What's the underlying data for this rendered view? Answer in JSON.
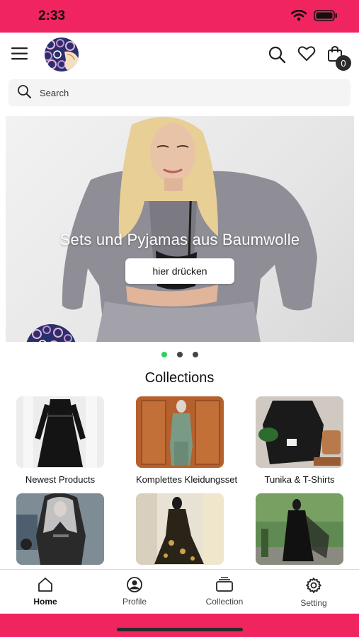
{
  "status_bar": {
    "time": "2:33"
  },
  "header": {
    "cart_count": "0"
  },
  "search": {
    "placeholder": "Search"
  },
  "hero": {
    "title": "Sets und Pyjamas aus Baumwolle",
    "button_label": "hier drücken",
    "slide_count": 3,
    "active_slide": 1
  },
  "collections": {
    "title": "Collections",
    "items": [
      {
        "label": "Newest Products"
      },
      {
        "label": "Komplettes Kleidungsset"
      },
      {
        "label": "Tunika & T-Shirts"
      },
      {
        "label": ""
      },
      {
        "label": ""
      },
      {
        "label": ""
      }
    ]
  },
  "bottom_nav": {
    "items": [
      {
        "label": "Home",
        "icon": "home-icon",
        "active": true
      },
      {
        "label": "Profile",
        "icon": "profile-icon",
        "active": false
      },
      {
        "label": "Collection",
        "icon": "collection-icon",
        "active": false
      },
      {
        "label": "Setting",
        "icon": "gear-icon",
        "active": false
      }
    ]
  },
  "colors": {
    "accent": "#f0245e",
    "active_dot": "#2fcf64"
  }
}
